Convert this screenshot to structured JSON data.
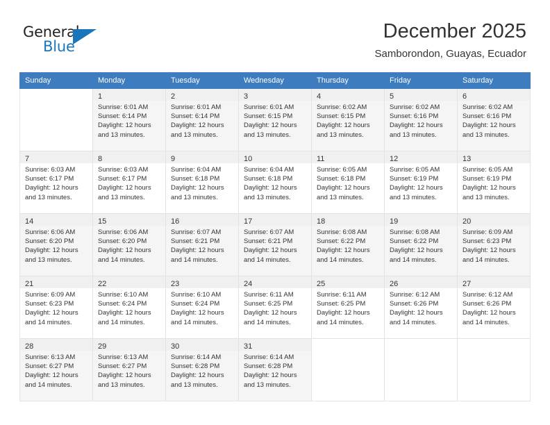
{
  "brand": {
    "name_top": "General",
    "name_bottom": "Blue",
    "accent_color": "#1b75bb"
  },
  "header": {
    "title": "December 2025",
    "subtitle": "Samborondon, Guayas, Ecuador"
  },
  "calendar": {
    "header_background": "#3d7cbf",
    "weekday_headers": [
      "Sunday",
      "Monday",
      "Tuesday",
      "Wednesday",
      "Thursday",
      "Friday",
      "Saturday"
    ],
    "weeks": [
      [
        {
          "day": ""
        },
        {
          "day": "1",
          "sunrise": "Sunrise: 6:01 AM",
          "sunset": "Sunset: 6:14 PM",
          "daylight_line1": "Daylight: 12 hours",
          "daylight_line2": "and 13 minutes."
        },
        {
          "day": "2",
          "sunrise": "Sunrise: 6:01 AM",
          "sunset": "Sunset: 6:14 PM",
          "daylight_line1": "Daylight: 12 hours",
          "daylight_line2": "and 13 minutes."
        },
        {
          "day": "3",
          "sunrise": "Sunrise: 6:01 AM",
          "sunset": "Sunset: 6:15 PM",
          "daylight_line1": "Daylight: 12 hours",
          "daylight_line2": "and 13 minutes."
        },
        {
          "day": "4",
          "sunrise": "Sunrise: 6:02 AM",
          "sunset": "Sunset: 6:15 PM",
          "daylight_line1": "Daylight: 12 hours",
          "daylight_line2": "and 13 minutes."
        },
        {
          "day": "5",
          "sunrise": "Sunrise: 6:02 AM",
          "sunset": "Sunset: 6:16 PM",
          "daylight_line1": "Daylight: 12 hours",
          "daylight_line2": "and 13 minutes."
        },
        {
          "day": "6",
          "sunrise": "Sunrise: 6:02 AM",
          "sunset": "Sunset: 6:16 PM",
          "daylight_line1": "Daylight: 12 hours",
          "daylight_line2": "and 13 minutes."
        }
      ],
      [
        {
          "day": "7",
          "sunrise": "Sunrise: 6:03 AM",
          "sunset": "Sunset: 6:17 PM",
          "daylight_line1": "Daylight: 12 hours",
          "daylight_line2": "and 13 minutes."
        },
        {
          "day": "8",
          "sunrise": "Sunrise: 6:03 AM",
          "sunset": "Sunset: 6:17 PM",
          "daylight_line1": "Daylight: 12 hours",
          "daylight_line2": "and 13 minutes."
        },
        {
          "day": "9",
          "sunrise": "Sunrise: 6:04 AM",
          "sunset": "Sunset: 6:18 PM",
          "daylight_line1": "Daylight: 12 hours",
          "daylight_line2": "and 13 minutes."
        },
        {
          "day": "10",
          "sunrise": "Sunrise: 6:04 AM",
          "sunset": "Sunset: 6:18 PM",
          "daylight_line1": "Daylight: 12 hours",
          "daylight_line2": "and 13 minutes."
        },
        {
          "day": "11",
          "sunrise": "Sunrise: 6:05 AM",
          "sunset": "Sunset: 6:18 PM",
          "daylight_line1": "Daylight: 12 hours",
          "daylight_line2": "and 13 minutes."
        },
        {
          "day": "12",
          "sunrise": "Sunrise: 6:05 AM",
          "sunset": "Sunset: 6:19 PM",
          "daylight_line1": "Daylight: 12 hours",
          "daylight_line2": "and 13 minutes."
        },
        {
          "day": "13",
          "sunrise": "Sunrise: 6:05 AM",
          "sunset": "Sunset: 6:19 PM",
          "daylight_line1": "Daylight: 12 hours",
          "daylight_line2": "and 13 minutes."
        }
      ],
      [
        {
          "day": "14",
          "sunrise": "Sunrise: 6:06 AM",
          "sunset": "Sunset: 6:20 PM",
          "daylight_line1": "Daylight: 12 hours",
          "daylight_line2": "and 13 minutes."
        },
        {
          "day": "15",
          "sunrise": "Sunrise: 6:06 AM",
          "sunset": "Sunset: 6:20 PM",
          "daylight_line1": "Daylight: 12 hours",
          "daylight_line2": "and 14 minutes."
        },
        {
          "day": "16",
          "sunrise": "Sunrise: 6:07 AM",
          "sunset": "Sunset: 6:21 PM",
          "daylight_line1": "Daylight: 12 hours",
          "daylight_line2": "and 14 minutes."
        },
        {
          "day": "17",
          "sunrise": "Sunrise: 6:07 AM",
          "sunset": "Sunset: 6:21 PM",
          "daylight_line1": "Daylight: 12 hours",
          "daylight_line2": "and 14 minutes."
        },
        {
          "day": "18",
          "sunrise": "Sunrise: 6:08 AM",
          "sunset": "Sunset: 6:22 PM",
          "daylight_line1": "Daylight: 12 hours",
          "daylight_line2": "and 14 minutes."
        },
        {
          "day": "19",
          "sunrise": "Sunrise: 6:08 AM",
          "sunset": "Sunset: 6:22 PM",
          "daylight_line1": "Daylight: 12 hours",
          "daylight_line2": "and 14 minutes."
        },
        {
          "day": "20",
          "sunrise": "Sunrise: 6:09 AM",
          "sunset": "Sunset: 6:23 PM",
          "daylight_line1": "Daylight: 12 hours",
          "daylight_line2": "and 14 minutes."
        }
      ],
      [
        {
          "day": "21",
          "sunrise": "Sunrise: 6:09 AM",
          "sunset": "Sunset: 6:23 PM",
          "daylight_line1": "Daylight: 12 hours",
          "daylight_line2": "and 14 minutes."
        },
        {
          "day": "22",
          "sunrise": "Sunrise: 6:10 AM",
          "sunset": "Sunset: 6:24 PM",
          "daylight_line1": "Daylight: 12 hours",
          "daylight_line2": "and 14 minutes."
        },
        {
          "day": "23",
          "sunrise": "Sunrise: 6:10 AM",
          "sunset": "Sunset: 6:24 PM",
          "daylight_line1": "Daylight: 12 hours",
          "daylight_line2": "and 14 minutes."
        },
        {
          "day": "24",
          "sunrise": "Sunrise: 6:11 AM",
          "sunset": "Sunset: 6:25 PM",
          "daylight_line1": "Daylight: 12 hours",
          "daylight_line2": "and 14 minutes."
        },
        {
          "day": "25",
          "sunrise": "Sunrise: 6:11 AM",
          "sunset": "Sunset: 6:25 PM",
          "daylight_line1": "Daylight: 12 hours",
          "daylight_line2": "and 14 minutes."
        },
        {
          "day": "26",
          "sunrise": "Sunrise: 6:12 AM",
          "sunset": "Sunset: 6:26 PM",
          "daylight_line1": "Daylight: 12 hours",
          "daylight_line2": "and 14 minutes."
        },
        {
          "day": "27",
          "sunrise": "Sunrise: 6:12 AM",
          "sunset": "Sunset: 6:26 PM",
          "daylight_line1": "Daylight: 12 hours",
          "daylight_line2": "and 14 minutes."
        }
      ],
      [
        {
          "day": "28",
          "sunrise": "Sunrise: 6:13 AM",
          "sunset": "Sunset: 6:27 PM",
          "daylight_line1": "Daylight: 12 hours",
          "daylight_line2": "and 14 minutes."
        },
        {
          "day": "29",
          "sunrise": "Sunrise: 6:13 AM",
          "sunset": "Sunset: 6:27 PM",
          "daylight_line1": "Daylight: 12 hours",
          "daylight_line2": "and 13 minutes."
        },
        {
          "day": "30",
          "sunrise": "Sunrise: 6:14 AM",
          "sunset": "Sunset: 6:28 PM",
          "daylight_line1": "Daylight: 12 hours",
          "daylight_line2": "and 13 minutes."
        },
        {
          "day": "31",
          "sunrise": "Sunrise: 6:14 AM",
          "sunset": "Sunset: 6:28 PM",
          "daylight_line1": "Daylight: 12 hours",
          "daylight_line2": "and 13 minutes."
        },
        {
          "day": ""
        },
        {
          "day": ""
        },
        {
          "day": ""
        }
      ]
    ]
  }
}
